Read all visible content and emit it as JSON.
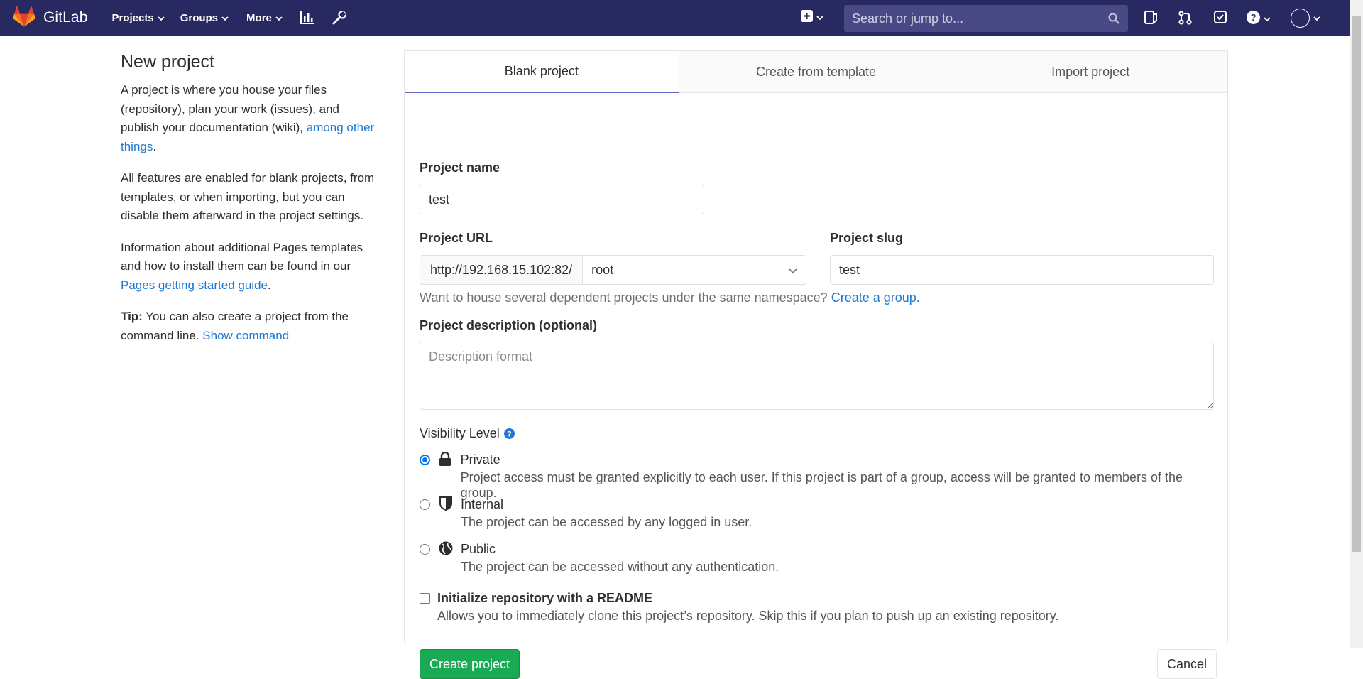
{
  "navbar": {
    "brand": "GitLab",
    "menu": [
      {
        "label": "Projects"
      },
      {
        "label": "Groups"
      },
      {
        "label": "More"
      }
    ],
    "search_placeholder": "Search or jump to...",
    "colors": {
      "background": "#292961",
      "search_bg": "#494985"
    }
  },
  "sidebar": {
    "title": "New project",
    "p1_text": "A project is where you house your files (repository), plan your work (issues), and publish your documentation (wiki), ",
    "p1_link": "among other things",
    "p1_end": ".",
    "p2_text": "All features are enabled for blank projects, from templates, or when importing, but you can disable them afterward in the project settings.",
    "p3_text": "Information about additional Pages templates and how to install them can be found in our ",
    "p3_link": "Pages getting started guide",
    "p3_end": ".",
    "tip_label": "Tip:",
    "tip_text": " You can also create a project from the command line. ",
    "tip_link": "Show command"
  },
  "tabs": [
    {
      "label": "Blank project",
      "active": true
    },
    {
      "label": "Create from template",
      "active": false
    },
    {
      "label": "Import project",
      "active": false
    }
  ],
  "form": {
    "project_name_label": "Project name",
    "project_name_value": "test",
    "project_url_label": "Project URL",
    "project_url_prefix": "http://192.168.15.102:82/",
    "namespace_value": "root",
    "project_slug_label": "Project slug",
    "project_slug_value": "test",
    "namespace_help": "Want to house several dependent projects under the same namespace? ",
    "namespace_help_link": "Create a group.",
    "description_label": "Project description (optional)",
    "description_placeholder": "Description format",
    "visibility_label": "Visibility Level",
    "visibility_options": [
      {
        "title": "Private",
        "description": "Project access must be granted explicitly to each user. If this project is part of a group, access will be granted to members of the group.",
        "checked": true,
        "icon": "lock-icon"
      },
      {
        "title": "Internal",
        "description": "The project can be accessed by any logged in user.",
        "checked": false,
        "icon": "shield-icon"
      },
      {
        "title": "Public",
        "description": "The project can be accessed without any authentication.",
        "checked": false,
        "icon": "globe-icon"
      }
    ],
    "readme_label": "Initialize repository with a README",
    "readme_description": "Allows you to immediately clone this project’s repository. Skip this if you plan to push up an existing repository.",
    "readme_checked": false,
    "create_button": "Create project",
    "cancel_button": "Cancel"
  },
  "colors": {
    "link": "#1f78d1",
    "create_button": "#1aaa55",
    "active_tab_border": "#6666c4"
  }
}
